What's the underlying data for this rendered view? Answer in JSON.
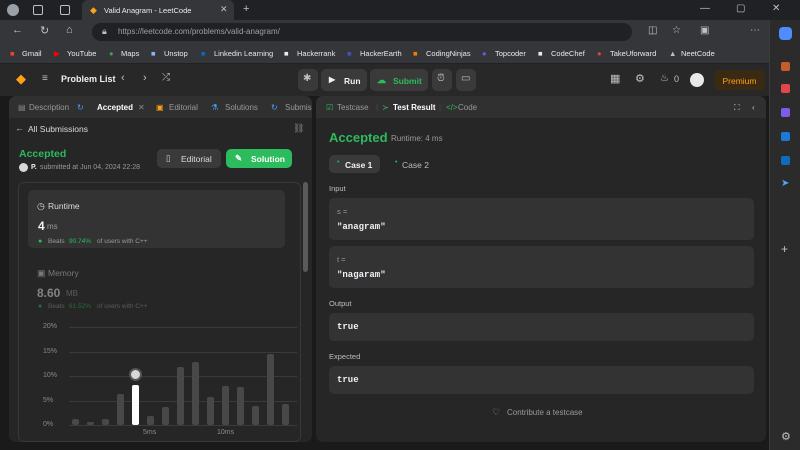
{
  "browser": {
    "tab_title": "Valid Anagram - LeetCode",
    "url": "https://leetcode.com/problems/valid-anagram/",
    "bookmarks": [
      "Gmail",
      "YouTube",
      "Maps",
      "Unstop",
      "Linkedin Learning",
      "Hackerrank",
      "HackerEarth",
      "CodingNinjas",
      "Topcoder",
      "CodeChef",
      "TakeUforward",
      "NeetCode"
    ]
  },
  "nav": {
    "problem_list": "Problem List",
    "run": "Run",
    "submit": "Submit",
    "streak": "0",
    "premium": "Premium"
  },
  "left": {
    "tabs": [
      "Description",
      "Accepted",
      "Editorial",
      "Solutions",
      "Submissions"
    ],
    "back": "All Submissions",
    "status": "Accepted",
    "user": "P.",
    "submitted": "submitted at Jun 04, 2024 22:28",
    "editorial_btn": "Editorial",
    "solution_btn": "Solution",
    "runtime_title": "Runtime",
    "runtime_value": "4",
    "runtime_unit": "ms",
    "runtime_beats_label": "Beats",
    "runtime_beats_pct": "90.74%",
    "runtime_beats_suffix": "of users with C++",
    "memory_title": "Memory",
    "memory_value": "8.60",
    "memory_unit": "MB",
    "memory_beats_label": "Beats",
    "memory_beats_pct": "61.52%",
    "memory_beats_suffix": "of users with C++"
  },
  "chart_data": {
    "type": "bar",
    "yticks": [
      "20%",
      "15%",
      "10%",
      "5%",
      "0%"
    ],
    "xticks": [
      "5ms",
      "10ms"
    ],
    "ylim": [
      0,
      20
    ],
    "values": [
      1.2,
      0.6,
      1.2,
      6.3,
      8.1,
      1.8,
      3.6,
      11.9,
      12.8,
      5.8,
      8.0,
      7.8,
      3.8,
      14.5,
      4.2
    ],
    "highlight_index": 4,
    "colors": {
      "bar": "#484848",
      "highlight": "#ffffff"
    }
  },
  "right": {
    "tab_testcase": "Testcase",
    "tab_result": "Test Result",
    "tab_code": "Code",
    "status": "Accepted",
    "runtime": "Runtime: 4 ms",
    "case1": "Case 1",
    "case2": "Case 2",
    "input_label": "Input",
    "s_label": "s =",
    "s_value": "\"anagram\"",
    "t_label": "t =",
    "t_value": "\"nagaram\"",
    "output_label": "Output",
    "output_value": "true",
    "expected_label": "Expected",
    "expected_value": "true",
    "contribute": "Contribute a testcase"
  },
  "colors": {
    "green": "#2cbb5d",
    "premium": "#ffa116"
  }
}
